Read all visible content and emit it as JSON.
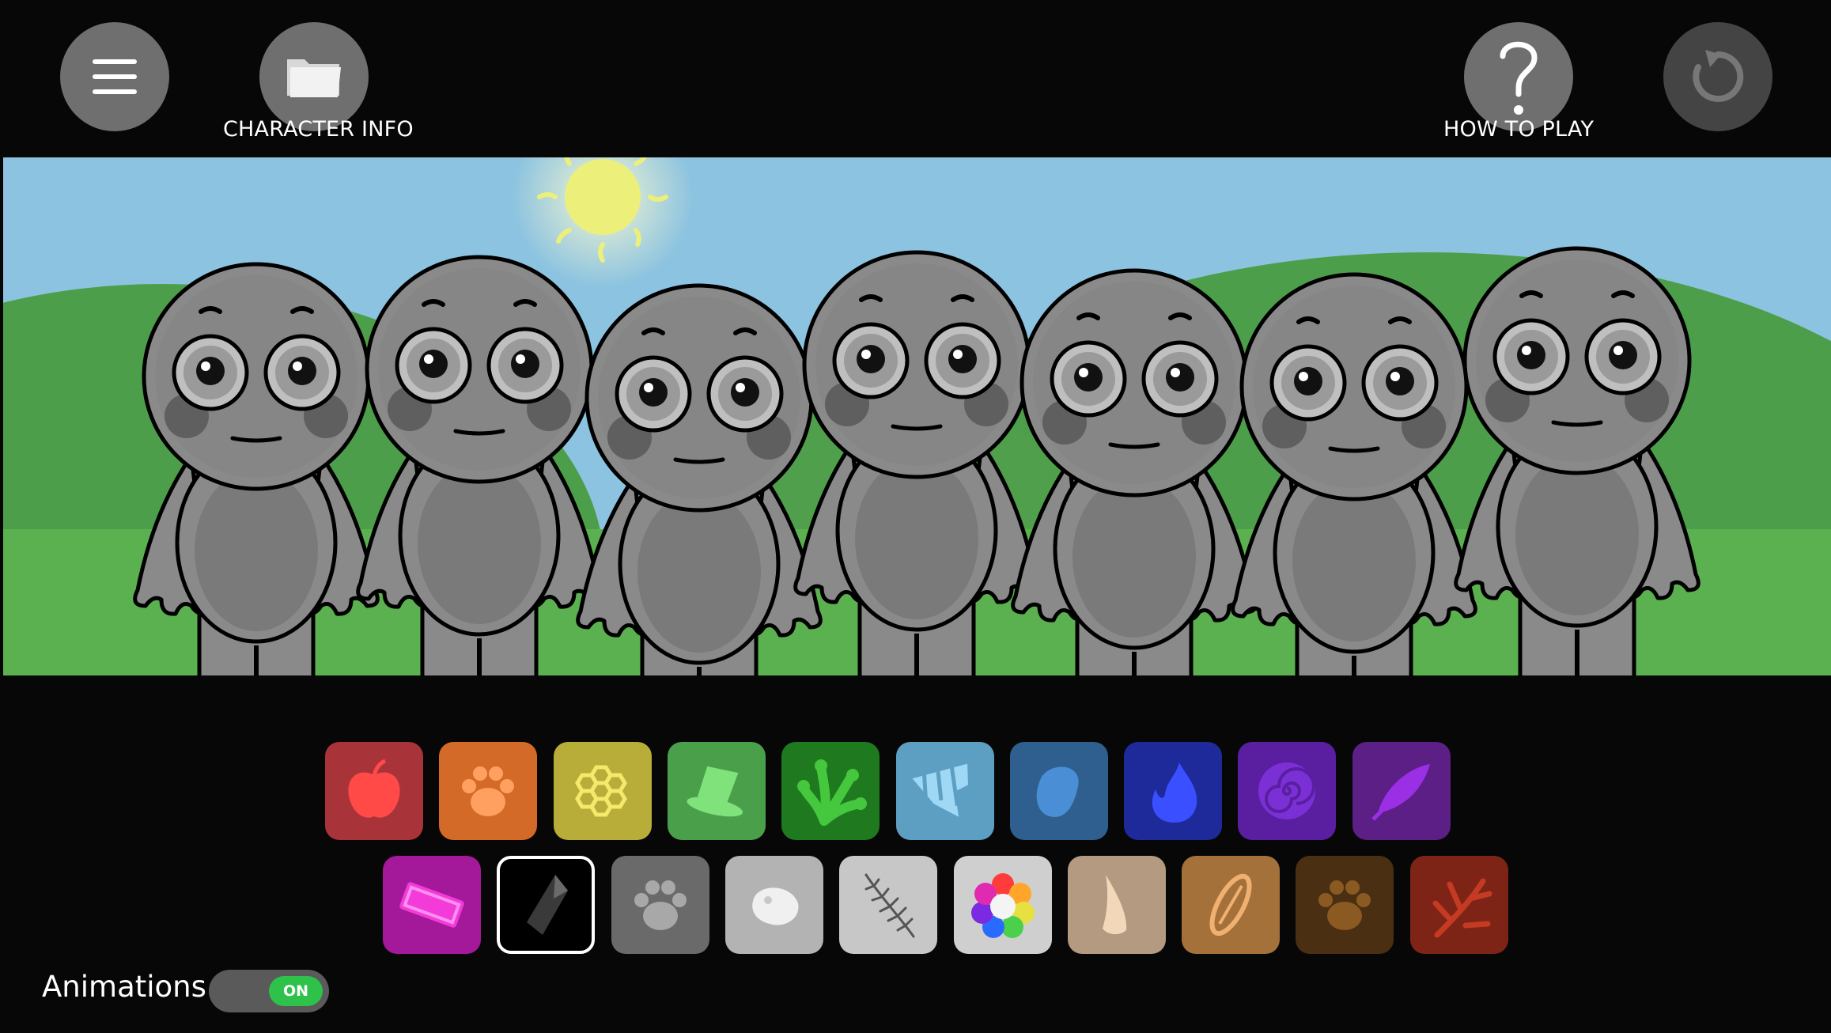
{
  "header": {
    "menu_icon": "hamburger-menu-icon",
    "character_info_label": "CHARACTER INFO",
    "character_info_icon": "folder-icon",
    "how_to_play_label": "HOW TO PLAY",
    "how_to_play_icon": "question-mark-icon",
    "reset_icon": "reset-arrow-icon"
  },
  "scene": {
    "sky_color": "#8cc3e0",
    "sun_color": "#ecf07a",
    "hill_color": "#4d9e4a",
    "grass_color": "#5bb14f",
    "character_count": 7,
    "character_color": "#8a8a8a"
  },
  "palette": {
    "row1": [
      {
        "icon": "apple-icon",
        "bg": "#a8343a"
      },
      {
        "icon": "paw-print-icon",
        "bg": "#d36a28"
      },
      {
        "icon": "honeycomb-icon",
        "bg": "#b9ad3a"
      },
      {
        "icon": "top-hat-icon",
        "bg": "#4aa04a"
      },
      {
        "icon": "frog-hand-icon",
        "bg": "#1f7a1f"
      },
      {
        "icon": "striped-cloth-icon",
        "bg": "#5d9fc3"
      },
      {
        "icon": "water-drop-icon",
        "bg": "#2f5f8f"
      },
      {
        "icon": "blue-flame-icon",
        "bg": "#1f2a9a"
      },
      {
        "icon": "spiral-icon",
        "bg": "#5a1fa0"
      },
      {
        "icon": "feather-quill-icon",
        "bg": "#5b1f86"
      }
    ],
    "row2": [
      {
        "icon": "eraser-icon",
        "bg": "#a3199a"
      },
      {
        "icon": "obsidian-shard-icon",
        "bg": "#000000",
        "selected": true
      },
      {
        "icon": "grey-paw-icon",
        "bg": "#6a6a6a"
      },
      {
        "icon": "stone-icon",
        "bg": "#b3b3b3"
      },
      {
        "icon": "fern-leaf-icon",
        "bg": "#c7c7c7"
      },
      {
        "icon": "rainbow-flower-icon",
        "bg": "#cfcfcf"
      },
      {
        "icon": "horn-icon",
        "bg": "#b39a80"
      },
      {
        "icon": "bread-icon",
        "bg": "#a4713a"
      },
      {
        "icon": "brown-paw-icon",
        "bg": "#4a2f12"
      },
      {
        "icon": "coral-icon",
        "bg": "#7d2416"
      }
    ]
  },
  "footer": {
    "animations_label": "Animations",
    "toggle_state": "ON",
    "toggle_color": "#2ec24a"
  }
}
